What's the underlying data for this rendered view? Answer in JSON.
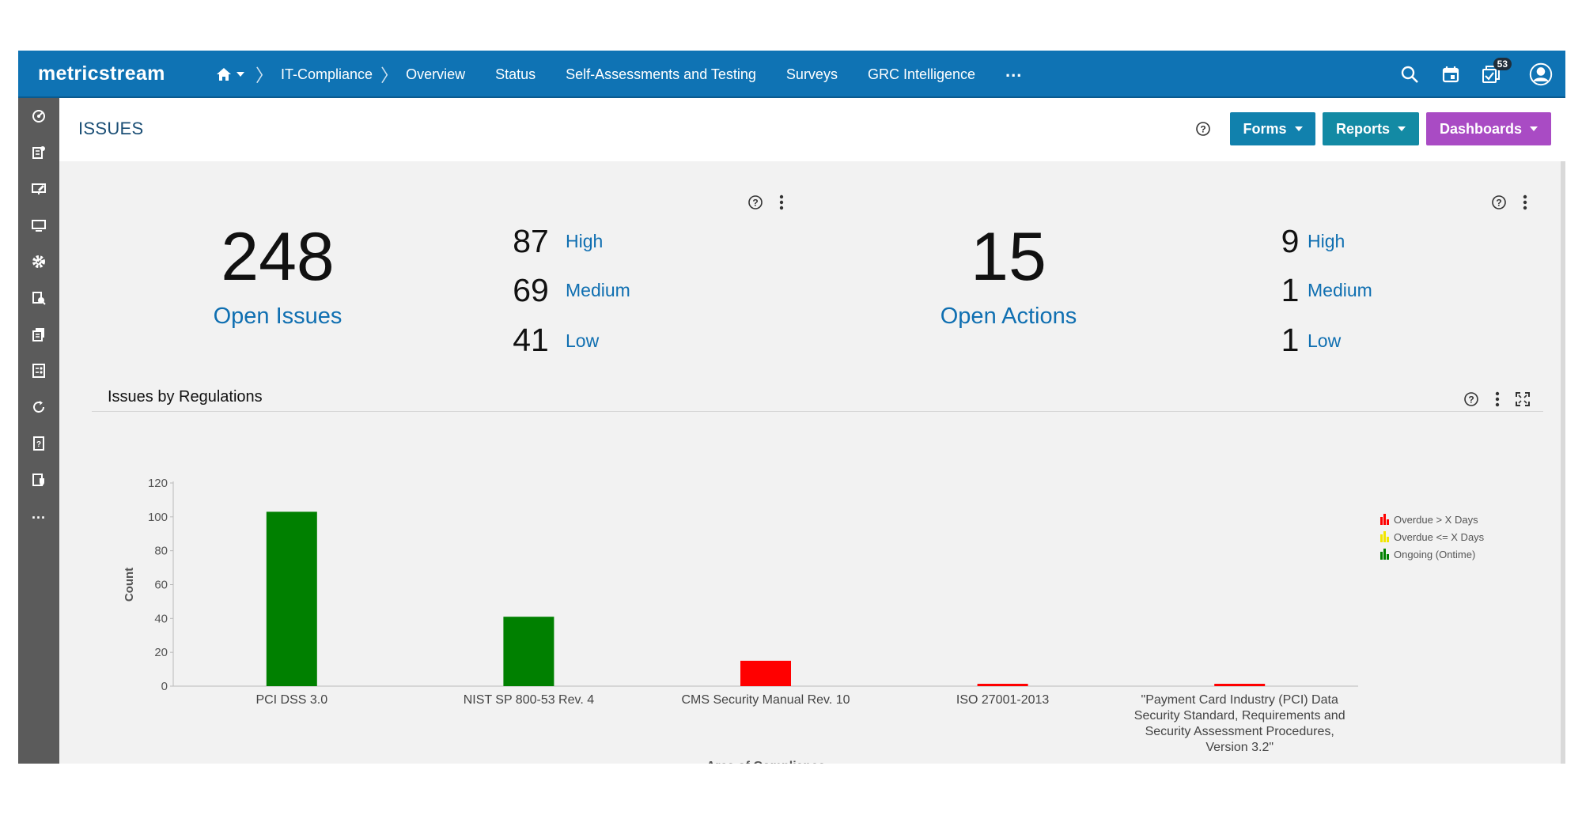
{
  "app": {
    "logo": "metricstream"
  },
  "nav": {
    "breadcrumb": "IT-Compliance",
    "items": [
      "Overview",
      "Status",
      "Self-Assessments and Testing",
      "Surveys",
      "GRC Intelligence"
    ],
    "more": "...",
    "notifications_count": "53"
  },
  "page": {
    "title": "ISSUES",
    "buttons": {
      "forms": "Forms",
      "reports": "Reports",
      "dashboards": "Dashboards"
    },
    "colors": {
      "forms": "#1181ad",
      "reports": "#138aa4",
      "dashboards": "#a94bc4"
    }
  },
  "sidebar": {
    "icons": [
      "dashboard-icon",
      "issue-report-icon",
      "monitor-edit-icon",
      "desktop-icon",
      "settings-check-icon",
      "document-search-icon",
      "documents-icon",
      "checklist-icon",
      "refresh-icon",
      "document-help-icon",
      "document-shield-icon"
    ],
    "more": "..."
  },
  "issues_summary": {
    "total": "248",
    "total_label": "Open Issues",
    "high": "87",
    "high_label": "High",
    "medium": "69",
    "medium_label": "Medium",
    "low": "41",
    "low_label": "Low"
  },
  "actions_summary": {
    "total": "15",
    "total_label": "Open Actions",
    "high": "9",
    "high_label": "High",
    "medium": "1",
    "medium_label": "Medium",
    "low": "1",
    "low_label": "Low"
  },
  "regulations_widget": {
    "title": "Issues by Regulations"
  },
  "chart_data": {
    "type": "bar",
    "title": "",
    "xlabel": "Area of Compliance",
    "ylabel": "Count",
    "ylim": [
      0,
      120
    ],
    "yticks": [
      0,
      20,
      40,
      60,
      80,
      100,
      120
    ],
    "categories": [
      [
        "PCI DSS 3.0"
      ],
      [
        "NIST SP 800-53 Rev. 4"
      ],
      [
        "CMS Security Manual Rev. 10"
      ],
      [
        "ISO 27001-2013"
      ],
      [
        "\"Payment Card Industry (PCI) Data",
        "Security Standard, Requirements and",
        "Security Assessment Procedures,",
        "Version 3.2\""
      ]
    ],
    "series": [
      {
        "name": "Overdue > X Days",
        "color": "#ff0000",
        "values": [
          0,
          0,
          15,
          1,
          1
        ]
      },
      {
        "name": "Overdue <= X Days",
        "color": "#f2e600",
        "values": [
          0,
          0,
          0,
          0,
          0
        ]
      },
      {
        "name": "Ongoing (Ontime)",
        "color": "#008000",
        "values": [
          103,
          41,
          0,
          0,
          0
        ]
      }
    ],
    "legend_position": "right",
    "grid": false
  }
}
